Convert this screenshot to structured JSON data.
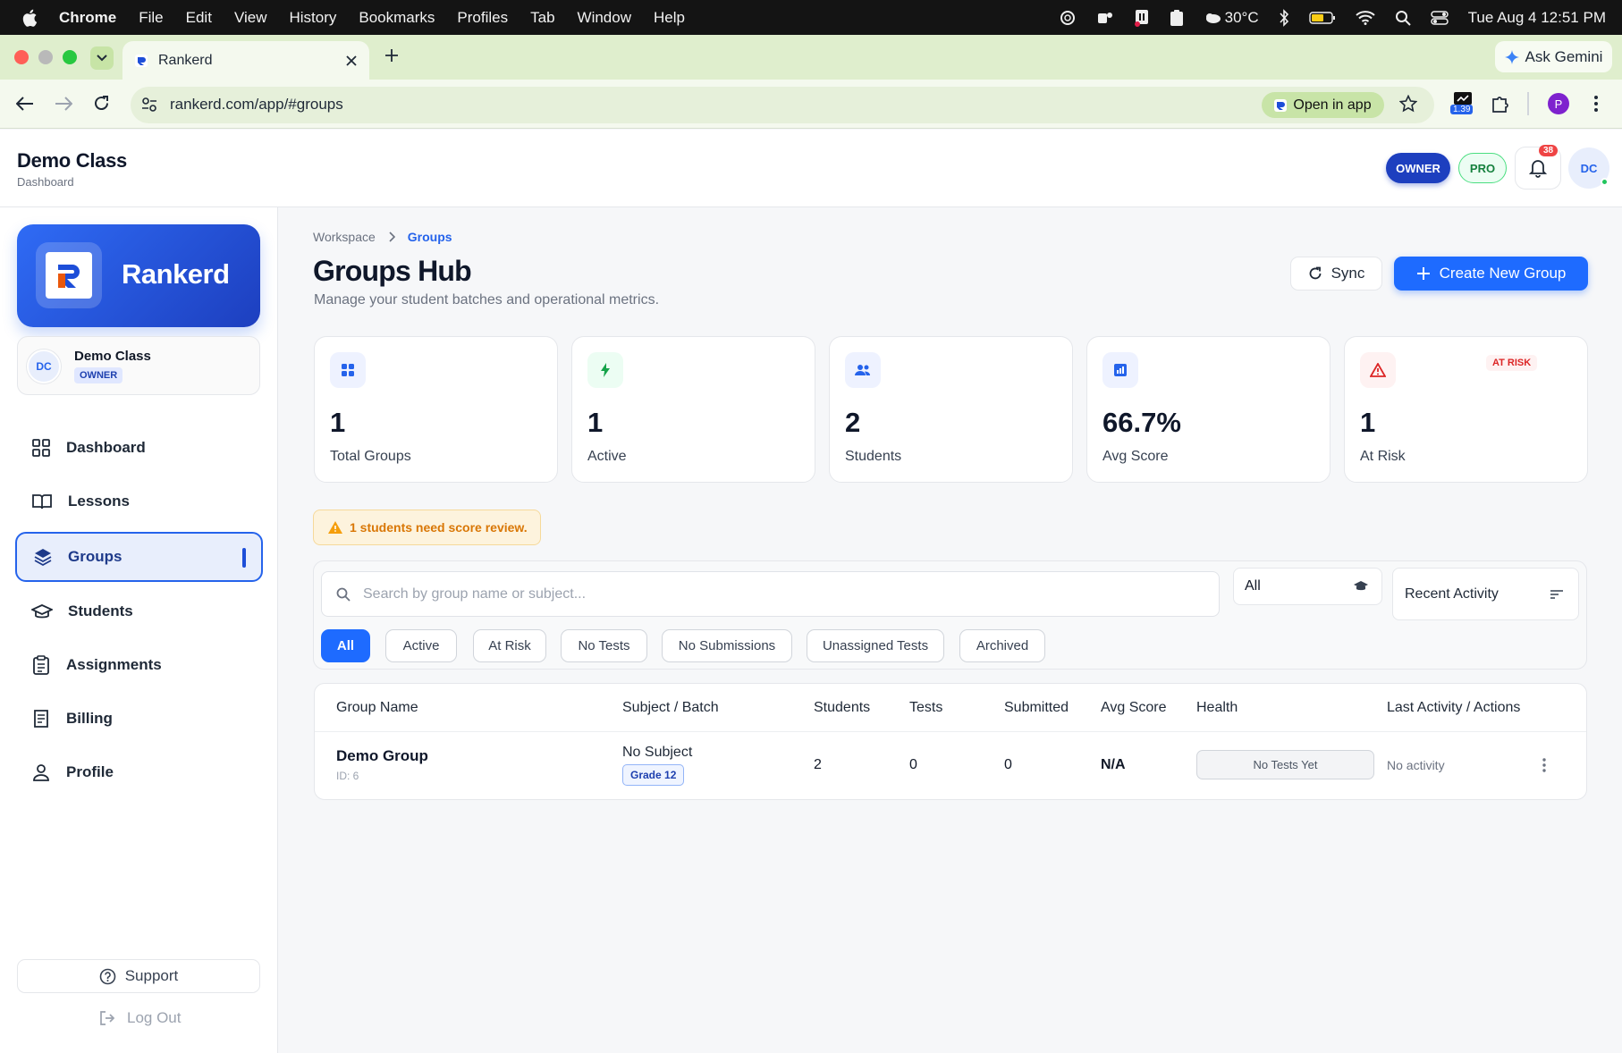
{
  "menubar": {
    "app": "Chrome",
    "items": [
      "File",
      "Edit",
      "View",
      "History",
      "Bookmarks",
      "Profiles",
      "Tab",
      "Window",
      "Help"
    ],
    "weather": "30°C",
    "datetime": "Tue Aug 4  12:51 PM"
  },
  "browser": {
    "tab_title": "Rankerd",
    "url": "rankerd.com/app/#groups",
    "open_in_app": "Open in app",
    "ask_gemini": "Ask Gemini",
    "extension_badge": "1.39",
    "profile_initial": "P"
  },
  "header": {
    "title": "Demo Class",
    "subtitle": "Dashboard",
    "role_badge": "OWNER",
    "plan_badge": "PRO",
    "notifications": "38",
    "avatar": "DC"
  },
  "sidebar": {
    "brand": "Rankerd",
    "user": {
      "initials": "DC",
      "name": "Demo Class",
      "role": "OWNER"
    },
    "items": [
      {
        "label": "Dashboard",
        "icon": "grid-icon"
      },
      {
        "label": "Lessons",
        "icon": "book-icon"
      },
      {
        "label": "Groups",
        "icon": "layers-icon",
        "active": true
      },
      {
        "label": "Students",
        "icon": "graduation-cap-icon"
      },
      {
        "label": "Assignments",
        "icon": "clipboard-icon"
      },
      {
        "label": "Billing",
        "icon": "receipt-icon"
      },
      {
        "label": "Profile",
        "icon": "user-icon"
      }
    ],
    "support": "Support",
    "logout": "Log Out"
  },
  "main": {
    "breadcrumb": [
      "Workspace",
      "Groups"
    ],
    "title": "Groups Hub",
    "subtitle": "Manage your student batches and operational metrics.",
    "sync_label": "Sync",
    "create_label": "Create New Group",
    "stats": [
      {
        "value": "1",
        "label": "Total Groups",
        "color": "#2563eb"
      },
      {
        "value": "1",
        "label": "Active",
        "color": "#16a34a"
      },
      {
        "value": "2",
        "label": "Students",
        "color": "#2563eb"
      },
      {
        "value": "66.7%",
        "label": "Avg Score",
        "color": "#2563eb"
      },
      {
        "value": "1",
        "label": "At Risk",
        "color": "#dc2626",
        "badge": "AT RISK"
      }
    ],
    "alert": "1 students need score review.",
    "search_placeholder": "Search by group name or subject...",
    "filter_select": "All",
    "sort_select": "Recent Activity",
    "chips": [
      "All",
      "Active",
      "At Risk",
      "No Tests",
      "No Submissions",
      "Unassigned Tests",
      "Archived"
    ],
    "table": {
      "headers": [
        "Group Name",
        "Subject / Batch",
        "Students",
        "Tests",
        "Submitted",
        "Avg Score",
        "Health",
        "Last Activity / Actions"
      ],
      "rows": [
        {
          "name": "Demo Group",
          "id": "ID: 6",
          "subject": "No Subject",
          "batch": "Grade 12",
          "students": "2",
          "tests": "0",
          "submitted": "0",
          "avg": "N/A",
          "health": "No Tests Yet",
          "activity": "No activity"
        }
      ]
    }
  },
  "colors": {
    "accent": "#1e6bff",
    "brand_gradient_start": "#2f6bf5",
    "tabbar": "#dfeecd"
  }
}
